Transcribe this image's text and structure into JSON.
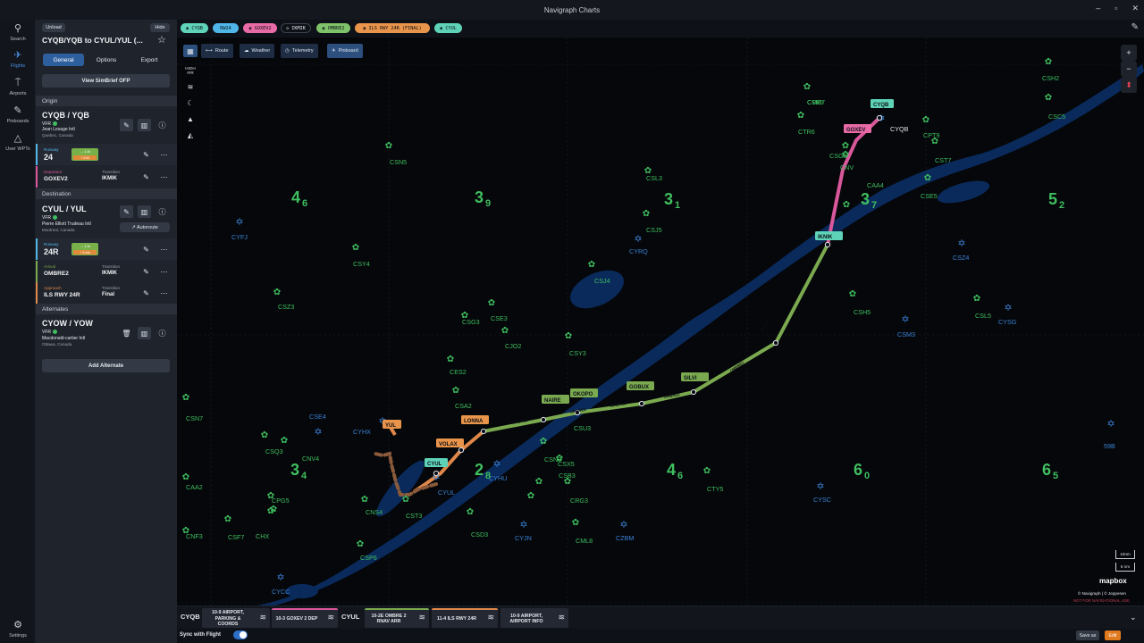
{
  "window": {
    "title": "Navigraph Charts",
    "minimize": "–",
    "maximize": "▫",
    "close": "✕"
  },
  "rail": [
    {
      "label": "Search",
      "icon": "search-icon",
      "glyph": "⚲"
    },
    {
      "label": "Flights",
      "icon": "plane-icon",
      "glyph": "✈"
    },
    {
      "label": "Airports",
      "icon": "airport-icon",
      "glyph": "⍑"
    },
    {
      "label": "Pinboards",
      "icon": "pin-icon",
      "glyph": "✎"
    },
    {
      "label": "User WPTs",
      "icon": "triangle-icon",
      "glyph": "△"
    }
  ],
  "settings": {
    "label": "Settings",
    "glyph": "⚙"
  },
  "panel": {
    "unload": "Unload",
    "hide": "Hide",
    "title": "CYQB/YQB to CYUL/YUL (...",
    "tabs": [
      "General",
      "Options",
      "Export"
    ],
    "simbrief": "View SimBrief OFP",
    "origin": {
      "header": "Origin",
      "code": "CYQB / YQB",
      "rules": "VFR",
      "name": "Jean Lesage Intl",
      "city": "Quebec, Canada",
      "runway_label": "Runway",
      "runway": "24",
      "wind_head": "→ 1 kt",
      "wind_tail": "↑ 6 kt",
      "departure_label": "Departure",
      "departure": "GOXEV2",
      "transition_label": "Transition",
      "transition": "IKMIK"
    },
    "destination": {
      "header": "Destination",
      "code": "CYUL / YUL",
      "rules": "VFR",
      "name": "Pierre Elliott Trudeau Intl",
      "city": "Montreal, Canada",
      "autoroute": "↗ Autoroute",
      "runway_label": "Runway",
      "runway": "24R",
      "wind_head": "→ 1 kt",
      "wind_tail": "↑ 6 kts",
      "arrival_label": "Arrival",
      "arrival": "OMBRE2",
      "arr_transition_label": "Transition",
      "arr_transition": "IKMIK",
      "approach_label": "Approach",
      "approach": "ILS RWY 24R",
      "app_transition_label": "Transition",
      "app_transition": "Final"
    },
    "alternates": {
      "header": "Alternates",
      "code": "CYOW / YOW",
      "rules": "VFR",
      "name": "Macdonald-cartier Intl",
      "city": "Ottawa, Canada",
      "add": "Add Alternate"
    }
  },
  "tags": [
    {
      "label": "◉ CYQB",
      "color": "#5fd3b8"
    },
    {
      "label": "RW24",
      "color": "#4fb6e8"
    },
    {
      "label": "◉ GOXEV2",
      "color": "#e86aa6"
    },
    {
      "label": "◇ IKMIK",
      "color": "#0e1218",
      "text": "#e6e9ee"
    },
    {
      "label": "◉ OMBRE2",
      "color": "#7ec26a"
    },
    {
      "label": "◉ ILS RWY 24R (FINAL)",
      "color": "#e8944a"
    },
    {
      "label": "◉ CYUL",
      "color": "#5fd3b8"
    }
  ],
  "map_tabs": [
    {
      "label": "Route",
      "glyph": "⟷"
    },
    {
      "label": "Weather",
      "glyph": "☁"
    },
    {
      "label": "Telemetry",
      "glyph": "◷"
    },
    {
      "label": "Pinboard",
      "glyph": "✈"
    }
  ],
  "map_tools": {
    "enroute": "HIGH IFR",
    "layers": "≋",
    "night": "☾",
    "north": "▲",
    "terrain": "◭"
  },
  "zoom": {
    "in": "+",
    "out": "−",
    "compass": "⬍"
  },
  "colors": {
    "accent": "#4a90e2",
    "route_green": "#7aa94f",
    "route_pink": "#d9579b",
    "route_orange": "#e0884a",
    "water": "#0a2a5c",
    "airport_green": "#3fbf5f",
    "vor_blue": "#3a82d6"
  },
  "map_labels": {
    "airports_green": [
      "CSK5",
      "CTR6",
      "CNV",
      "CSG5",
      "CPT9",
      "CST7",
      "CSE5",
      "CSH2",
      "CSC5",
      "CAA4",
      "CSL3",
      "CSJ5",
      "CSJ4",
      "CSH5",
      "CSL5",
      "CSN5",
      "CSZ3",
      "CSY4",
      "CSG3",
      "CSE3",
      "CJO2",
      "CSY3",
      "CES2",
      "CSA2",
      "CSU3",
      "CSN3",
      "CSB3",
      "CSX5",
      "CRG3",
      "CTY5",
      "CSQ3",
      "CNV4",
      "CPG5",
      "CNS4",
      "CST3",
      "CSP6",
      "CSD3",
      "CML8",
      "CSN7",
      "CAA2",
      "CNF3",
      "CSF7",
      "CHX",
      "CMB7"
    ],
    "airports_blue": [
      "CYQB",
      "CYRQ",
      "CYFJ",
      "CSZ4",
      "CYSG",
      "CSM3",
      "CSE4",
      "CYHX",
      "CYUL",
      "CYHU",
      "CYJN",
      "CZBM",
      "CYSC",
      "CYCC",
      "59B"
    ],
    "mora": [
      "4",
      "6",
      "3",
      "9",
      "3",
      "1",
      "3",
      "7",
      "5",
      "2",
      "3",
      "4",
      "2",
      "8",
      "4",
      "6",
      "6",
      "0",
      "6",
      "5"
    ],
    "waypoints": [
      "CYQB",
      "GOXEV",
      "IKNIK",
      "SILVI",
      "GOBUX",
      "OKOPO",
      "NAIRE",
      "LONNA",
      "VOLAX",
      "YUL",
      "CYUL"
    ],
    "segment": "OMBRE2"
  },
  "mapbox": "mapbox",
  "attribution": "© Navigraph | © Jeppesen",
  "nfn": "NOT FOR NAVIGATIONAL USE",
  "scale": [
    "10nm",
    "5 nm"
  ],
  "chartbar": {
    "origin_code": "CYQB",
    "dest_code": "CYUL",
    "cards": [
      {
        "title": "10-9 AIRPORT, PARKING & COORDS",
        "color": "#232833"
      },
      {
        "title": "10-3 GOXEV 2 DEP",
        "color": "#d9579b"
      },
      {
        "title": "10-2E OMBRE 2 RNAV ARR",
        "color": "#7aa94f"
      },
      {
        "title": "11-4 ILS RWY 24R",
        "color": "#e0884a"
      },
      {
        "title": "10-9 AIRPORT, AIRPORT INFO",
        "color": "#232833"
      }
    ]
  },
  "footer": {
    "sync": "Sync with Flight",
    "save_as": "Save as",
    "edit": "Edit"
  }
}
